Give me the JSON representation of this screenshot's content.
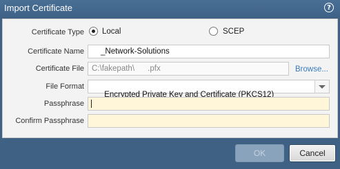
{
  "dialog": {
    "title": "Import Certificate",
    "help_icon_label": "?"
  },
  "form": {
    "certificate_type_label": "Certificate Type",
    "type_options": [
      {
        "label": "Local",
        "selected": true
      },
      {
        "label": "SCEP",
        "selected": false
      }
    ],
    "certificate_name_label": "Certificate Name",
    "certificate_name_value": "_Network-Solutions",
    "certificate_file_label": "Certificate File",
    "certificate_file_value": "C:\\fakepath\\      .pfx",
    "browse_label": "Browse...",
    "file_format_label": "File Format",
    "file_format_value": "Encrypted Private Key and Certificate (PKCS12)",
    "passphrase_label": "Passphrase",
    "passphrase_value": "",
    "confirm_passphrase_label": "Confirm Passphrase",
    "confirm_passphrase_value": ""
  },
  "buttons": {
    "ok_label": "OK",
    "cancel_label": "Cancel"
  },
  "colors": {
    "titlebar": "#3f6388",
    "passphrase_bg": "#fff5d8",
    "link": "#3a7bbf"
  }
}
